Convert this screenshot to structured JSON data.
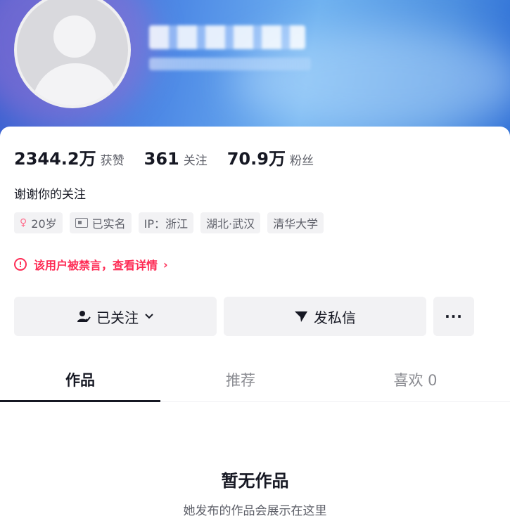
{
  "stats": [
    {
      "value": "2344.2万",
      "label": "获赞"
    },
    {
      "value": "361",
      "label": "关注"
    },
    {
      "value": "70.9万",
      "label": "粉丝"
    }
  ],
  "bio": "谢谢你的关注",
  "tags": {
    "age": "20岁",
    "verified": "已实名",
    "ip": "IP：浙江",
    "location": "湖北·武汉",
    "school": "清华大学"
  },
  "notice": {
    "icon": "!",
    "text": "该用户被禁言，查看详情",
    "arrow": "›"
  },
  "actions": {
    "follow_label": "已关注",
    "message_label": "发私信",
    "more_label": "···"
  },
  "tabs": [
    {
      "label": "作品",
      "active": true
    },
    {
      "label": "推荐",
      "active": false
    },
    {
      "label": "喜欢 0",
      "active": false
    }
  ],
  "empty": {
    "title": "暂无作品",
    "subtitle": "她发布的作品会展示在这里"
  },
  "colors": {
    "accent_red": "#fe2c55",
    "text_primary": "#161823",
    "text_secondary": "#5d5f68",
    "chip_bg": "#f2f2f4"
  },
  "icons": {
    "age": "female-symbol-icon",
    "verified": "id-card-icon",
    "notice": "alert-circle-icon",
    "follow": "person-check-icon",
    "message": "send-plane-icon"
  }
}
